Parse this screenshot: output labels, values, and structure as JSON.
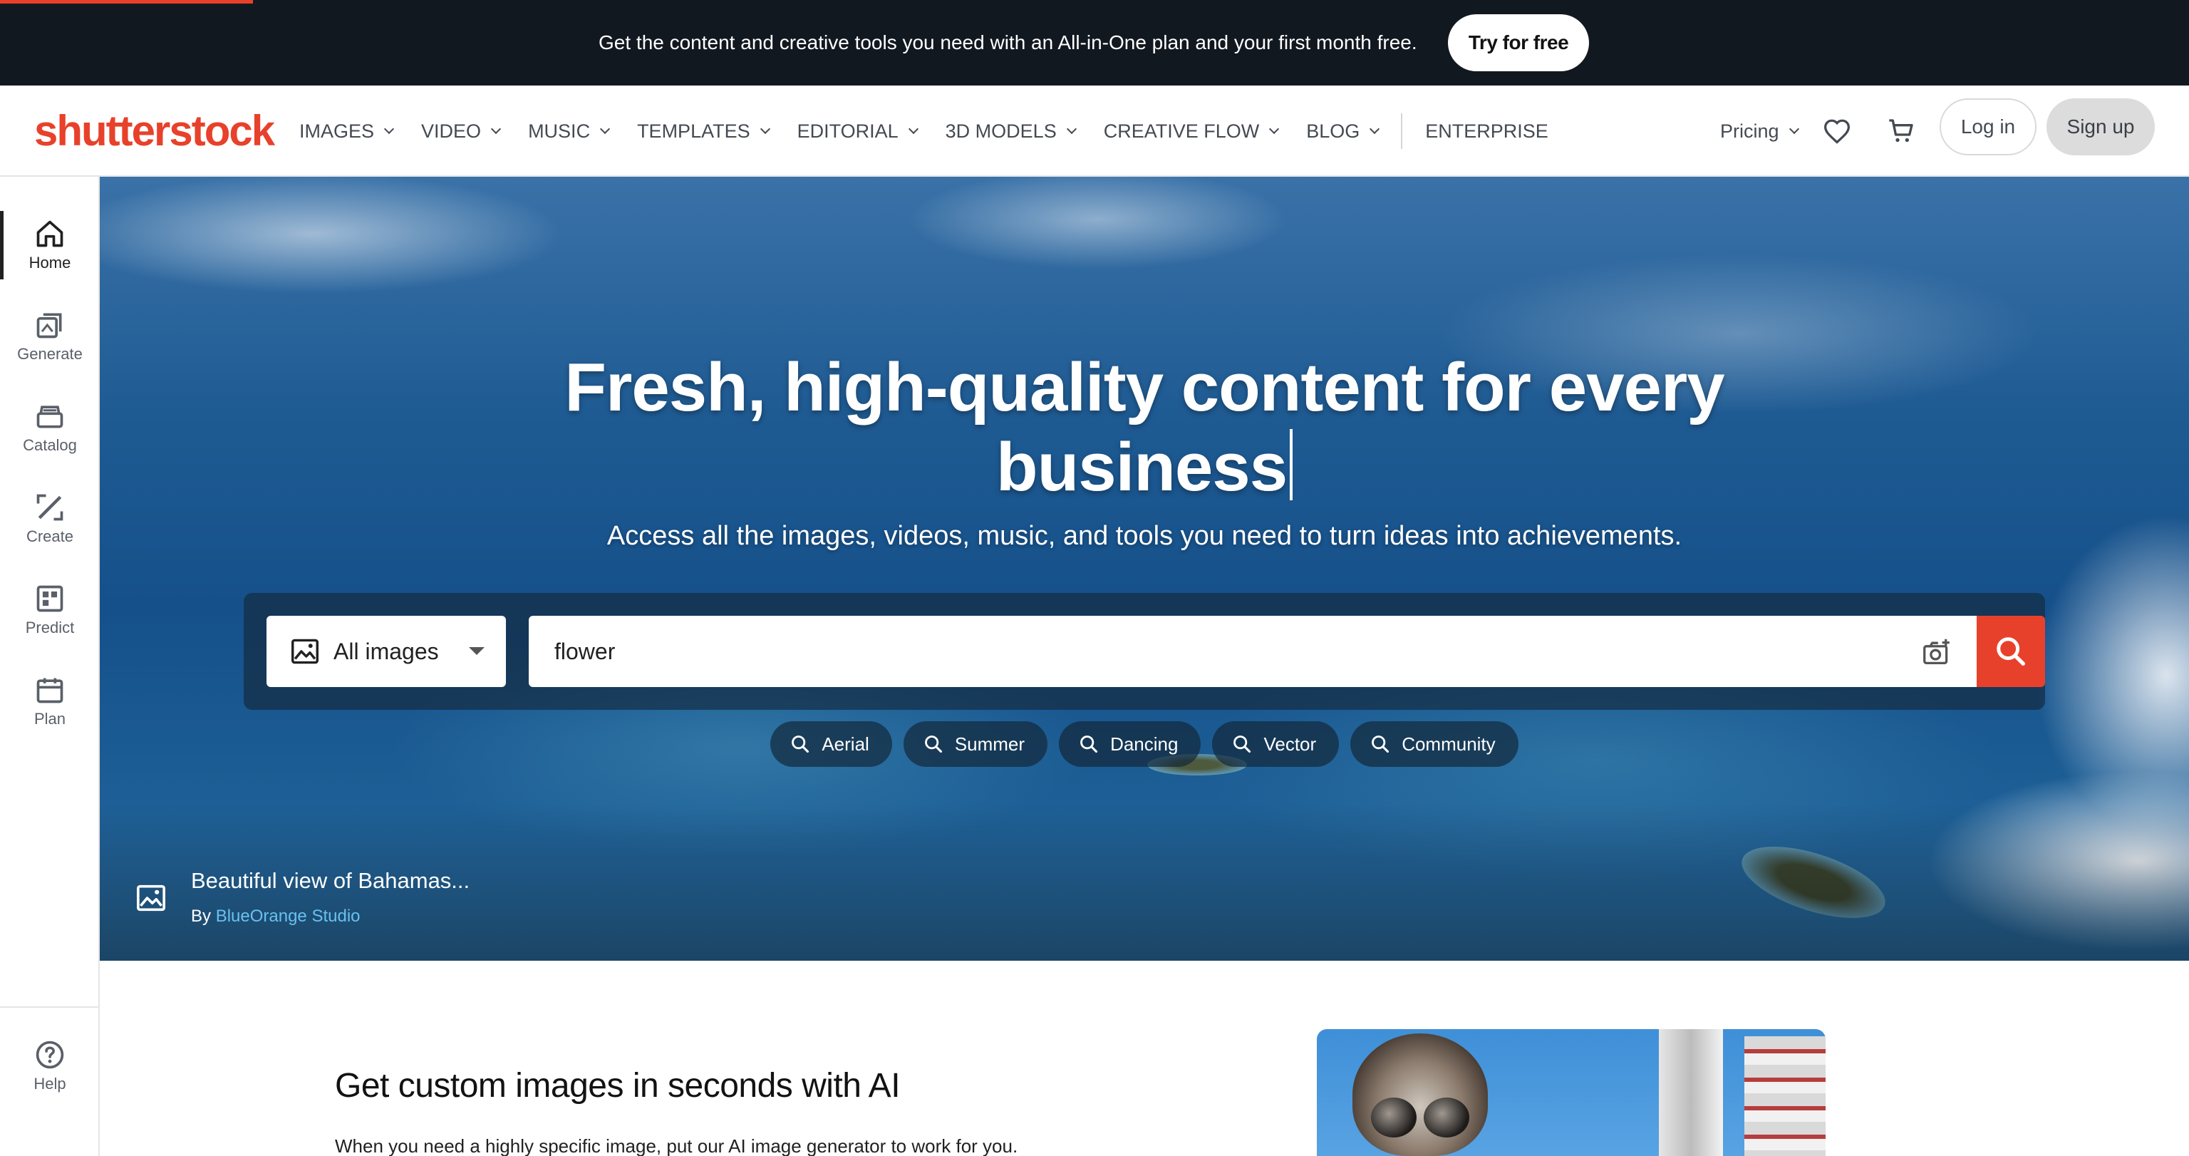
{
  "promo": {
    "message": "Get the content and creative tools you need with an All-in-One plan and your first month free.",
    "cta": "Try for free"
  },
  "header": {
    "logo": "shutterstock",
    "nav": [
      {
        "label": "IMAGES",
        "has_dropdown": true
      },
      {
        "label": "VIDEO",
        "has_dropdown": true
      },
      {
        "label": "MUSIC",
        "has_dropdown": true
      },
      {
        "label": "TEMPLATES",
        "has_dropdown": true
      },
      {
        "label": "EDITORIAL",
        "has_dropdown": true
      },
      {
        "label": "3D MODELS",
        "has_dropdown": true
      },
      {
        "label": "CREATIVE FLOW",
        "has_dropdown": true
      },
      {
        "label": "BLOG",
        "has_dropdown": true
      },
      {
        "label": "ENTERPRISE",
        "has_dropdown": false
      }
    ],
    "pricing": "Pricing",
    "login": "Log in",
    "signup": "Sign up"
  },
  "sidebar": {
    "items": [
      {
        "label": "Home",
        "icon": "home-icon",
        "active": true
      },
      {
        "label": "Generate",
        "icon": "generate-icon",
        "active": false
      },
      {
        "label": "Catalog",
        "icon": "catalog-icon",
        "active": false
      },
      {
        "label": "Create",
        "icon": "create-icon",
        "active": false
      },
      {
        "label": "Predict",
        "icon": "predict-icon",
        "active": false
      },
      {
        "label": "Plan",
        "icon": "plan-icon",
        "active": false
      }
    ],
    "help": "Help"
  },
  "hero": {
    "title_line1": "Fresh, high-quality content for every",
    "title_line2": "business",
    "subtitle": "Access all the images, videos, music, and tools you need to turn ideas into achievements.",
    "search": {
      "type_selected": "All images",
      "query": "flower"
    },
    "chips": [
      "Aerial",
      "Summer",
      "Dancing",
      "Vector",
      "Community"
    ],
    "caption": {
      "title": "Beautiful view of Bahamas...",
      "by_prefix": "By",
      "author": "BlueOrange Studio"
    }
  },
  "ai_section": {
    "heading": "Get custom images in seconds with AI",
    "text": "When you need a highly specific image, put our AI image generator to work for you."
  },
  "colors": {
    "brand": "#e8412b",
    "promo_bg": "#121820",
    "link": "#69c0f0"
  }
}
